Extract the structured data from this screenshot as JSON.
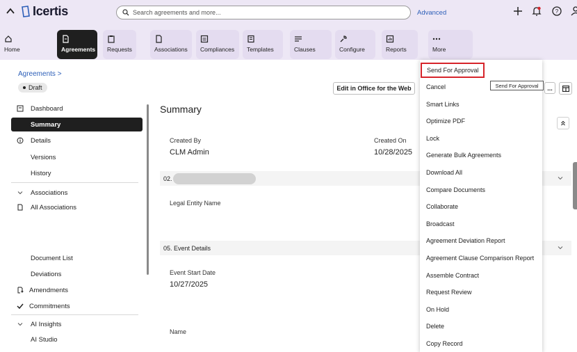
{
  "header": {
    "logo_text": "Icertis",
    "search_placeholder": "Search agreements and more...",
    "advanced_label": "Advanced",
    "icons": [
      "collapse-icon",
      "plus-icon",
      "notification-icon",
      "help-icon",
      "user-icon"
    ]
  },
  "nav": {
    "items": [
      {
        "label": "Home",
        "icon": "home-icon"
      },
      {
        "label": "Agreements",
        "icon": "document-icon"
      },
      {
        "label": "Requests",
        "icon": "clipboard-icon"
      },
      {
        "label": "Associations",
        "icon": "file-icon"
      },
      {
        "label": "Compliances",
        "icon": "checklist-icon"
      },
      {
        "label": "Templates",
        "icon": "template-icon"
      },
      {
        "label": "Clauses",
        "icon": "lines-icon"
      },
      {
        "label": "Configure",
        "icon": "wrench-icon"
      },
      {
        "label": "Reports",
        "icon": "report-icon"
      },
      {
        "label": "More",
        "icon": "more-icon"
      }
    ]
  },
  "breadcrumb": {
    "label": "Agreements >"
  },
  "status": {
    "label": "Draft"
  },
  "sidebar": {
    "items": [
      {
        "label": "Dashboard"
      },
      {
        "label": "Summary"
      },
      {
        "label": "Details"
      },
      {
        "label": "Versions"
      },
      {
        "label": "History"
      },
      {
        "label": "Associations"
      },
      {
        "label": "All Associations"
      },
      {
        "label": "Document List"
      },
      {
        "label": "Deviations"
      },
      {
        "label": "Amendments"
      },
      {
        "label": "Commitments"
      },
      {
        "label": "AI Insights"
      },
      {
        "label": "AI Studio"
      }
    ]
  },
  "main": {
    "title": "Summary",
    "edit_button": "Edit in Office for the Web",
    "created_by_label": "Created By",
    "created_by_value": "CLM Admin",
    "created_on_label": "Created On",
    "created_on_value": "10/28/2025",
    "section2_label": "02.",
    "legal_entity_label": "Legal Entity Name",
    "section5_label": "05. Event Details",
    "event_start_label": "Event Start Date",
    "event_start_value": "10/27/2025",
    "name_label": "Name"
  },
  "dropdown": {
    "items": [
      {
        "label": "Send For Approval"
      },
      {
        "label": "Cancel"
      },
      {
        "label": "Smart Links"
      },
      {
        "label": "Optimize PDF"
      },
      {
        "label": "Lock"
      },
      {
        "label": "Generate Bulk Agreements"
      },
      {
        "label": "Download All"
      },
      {
        "label": "Compare Documents"
      },
      {
        "label": "Collaborate"
      },
      {
        "label": "Broadcast"
      },
      {
        "label": "Agreement Deviation Report"
      },
      {
        "label": "Agreement Clause Comparison Report"
      },
      {
        "label": "Assemble Contract"
      },
      {
        "label": "Request Review"
      },
      {
        "label": "On Hold"
      },
      {
        "label": "Delete"
      },
      {
        "label": "Copy Record"
      }
    ],
    "tooltip": "Send For Approval",
    "more_label": "..."
  },
  "colors": {
    "accent_blue": "#2d5fb8",
    "header_bg": "#ede7f5",
    "active_dark": "#1f1f1f",
    "highlight_red": "#d6242a"
  }
}
